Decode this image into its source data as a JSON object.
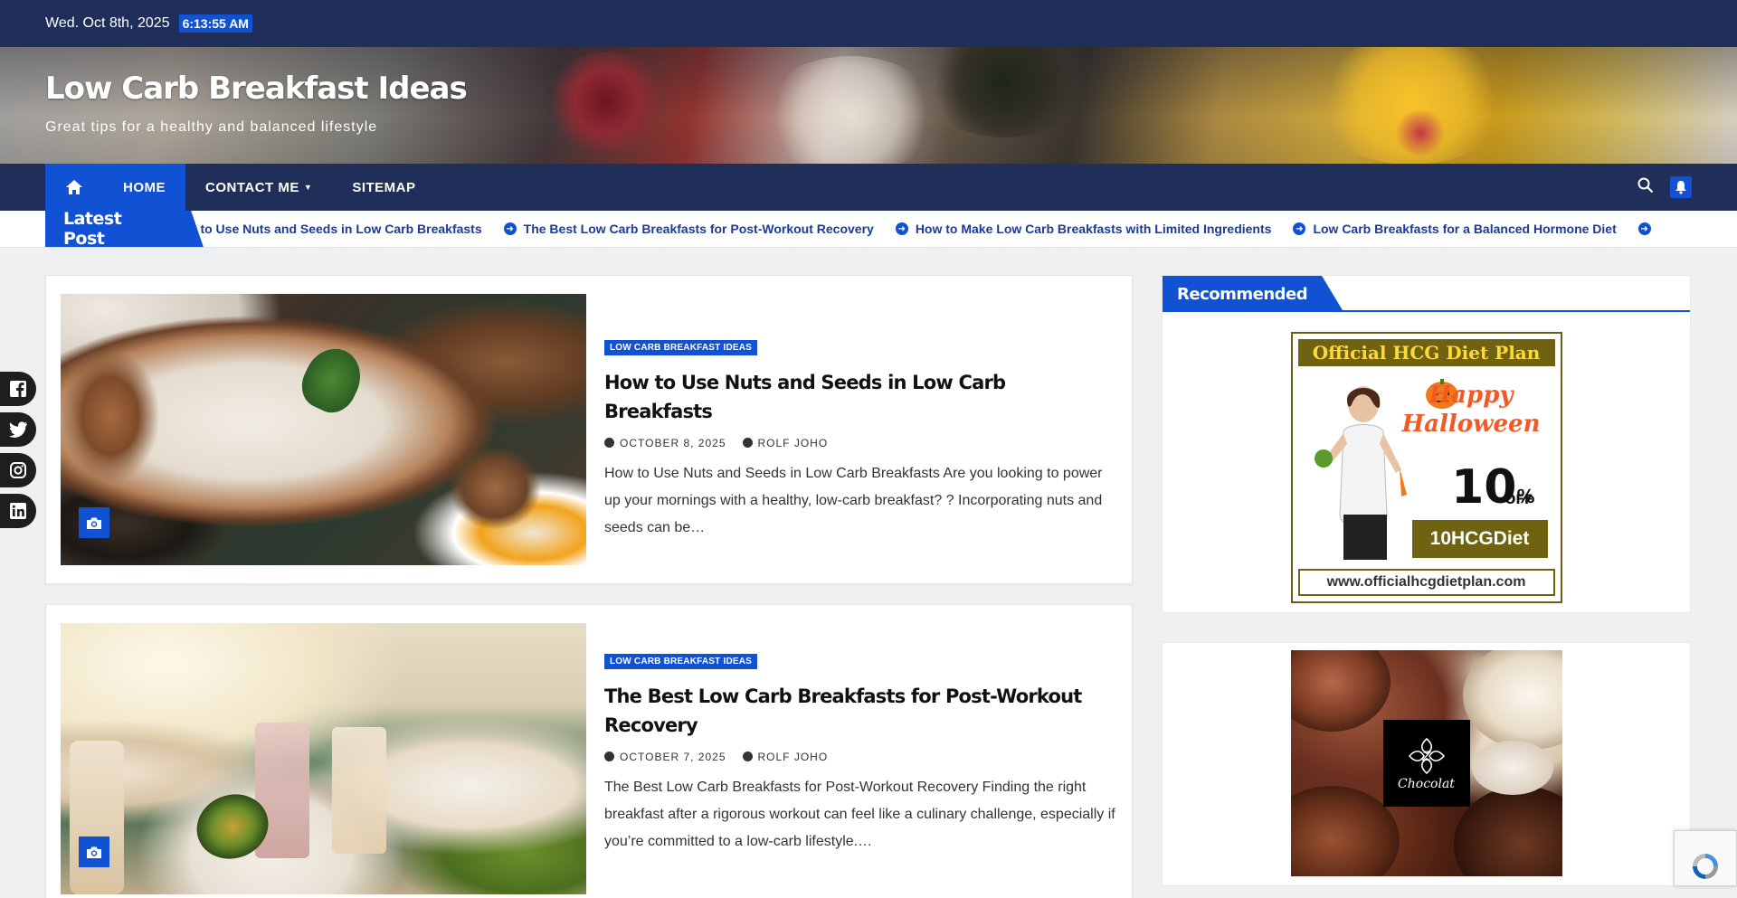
{
  "topbar": {
    "date": "Wed. Oct 8th, 2025",
    "time": "6:13:55 AM"
  },
  "site": {
    "title": "Low Carb Breakfast Ideas",
    "tagline": "Great tips for a healthy and balanced lifestyle"
  },
  "nav": {
    "items": [
      {
        "label": "HOME"
      },
      {
        "label": "CONTACT ME"
      },
      {
        "label": "SITEMAP"
      }
    ]
  },
  "ticker": {
    "label": "Latest Post",
    "items": [
      "How to Use Nuts and Seeds in Low Carb Breakfasts",
      "The Best Low Carb Breakfasts for Post-Workout Recovery",
      "How to Make Low Carb Breakfasts with Limited Ingredients",
      "Low Carb Breakfasts for a Balanced Hormone Diet"
    ]
  },
  "posts": [
    {
      "category": "LOW CARB BREAKFAST IDEAS",
      "title": "How to Use Nuts and Seeds in Low Carb Breakfasts",
      "date": "OCTOBER 8, 2025",
      "author": "ROLF JOHO",
      "excerpt": "How to Use Nuts and Seeds in Low Carb Breakfasts Are you looking to power up your mornings with a healthy, low-carb breakfast? ? Incorporating nuts and seeds can be…"
    },
    {
      "category": "LOW CARB BREAKFAST IDEAS",
      "title": "The Best Low Carb Breakfasts for Post-Workout Recovery",
      "date": "OCTOBER 7, 2025",
      "author": "ROLF JOHO",
      "excerpt": "The Best Low Carb Breakfasts for Post-Workout Recovery Finding the right breakfast after a rigorous workout can feel like a culinary challenge, especially if you’re committed to a low-carb lifestyle.…"
    }
  ],
  "sidebar": {
    "widget_title": "Recommended",
    "ad1": {
      "headline": "Official HCG Diet Plan",
      "promo_line1": "Happy",
      "promo_line2": "Halloween",
      "discount": "10",
      "discount_unit": "%",
      "off": "OFF",
      "code": "10HCGDiet",
      "url": "www.officialhcgdietplan.com"
    },
    "ad2": {
      "brand": "Chocolat"
    }
  },
  "icons": {
    "home": "home-icon",
    "search": "search-icon",
    "bell": "bell-icon",
    "camera": "camera-icon",
    "social": [
      "facebook-icon",
      "twitter-icon",
      "instagram-icon",
      "linkedin-icon"
    ]
  },
  "colors": {
    "navy": "#202f59",
    "accent": "#1151d3"
  }
}
